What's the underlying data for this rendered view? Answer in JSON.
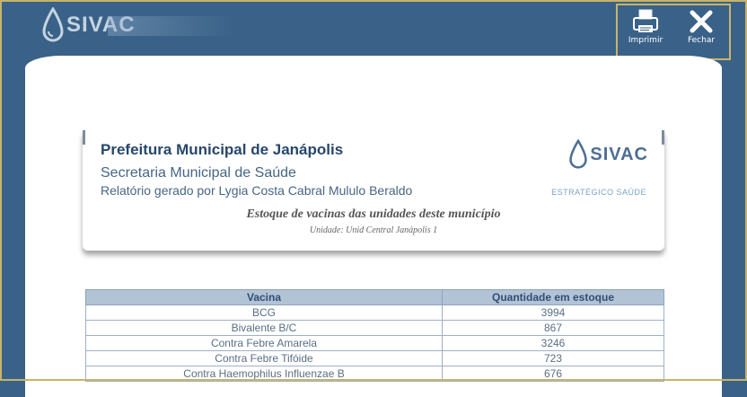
{
  "header": {
    "logo_text": "SIVAC",
    "print_label": "Imprimir",
    "close_label": "Fechar"
  },
  "report": {
    "title": "Prefeitura Municipal de Janápolis",
    "subtitle": "Secretaria Municipal de Saúde",
    "generated_by": "Relatório gerado por Lygia Costa Cabral Mululo Beraldo",
    "heading": "Estoque de vacinas das unidades deste município",
    "unit": "Unidade: Unid Central Janápolis 1",
    "logo_text": "SIVAC",
    "logo_tagline": "ESTRATÉGICO SAÚDE"
  },
  "table": {
    "headers": [
      "Vacina",
      "Quantidade em estoque"
    ],
    "rows": [
      [
        "BCG",
        "3994"
      ],
      [
        "Bivalente B/C",
        "867"
      ],
      [
        "Contra Febre Amarela",
        "3246"
      ],
      [
        "Contra Febre Tifóide",
        "723"
      ],
      [
        "Contra Haemophilus Influenzae B",
        "676"
      ]
    ]
  },
  "colors": {
    "background": "#3a6288",
    "highlight_border": "#c7b46a",
    "table_header": "#b3c3d6"
  }
}
